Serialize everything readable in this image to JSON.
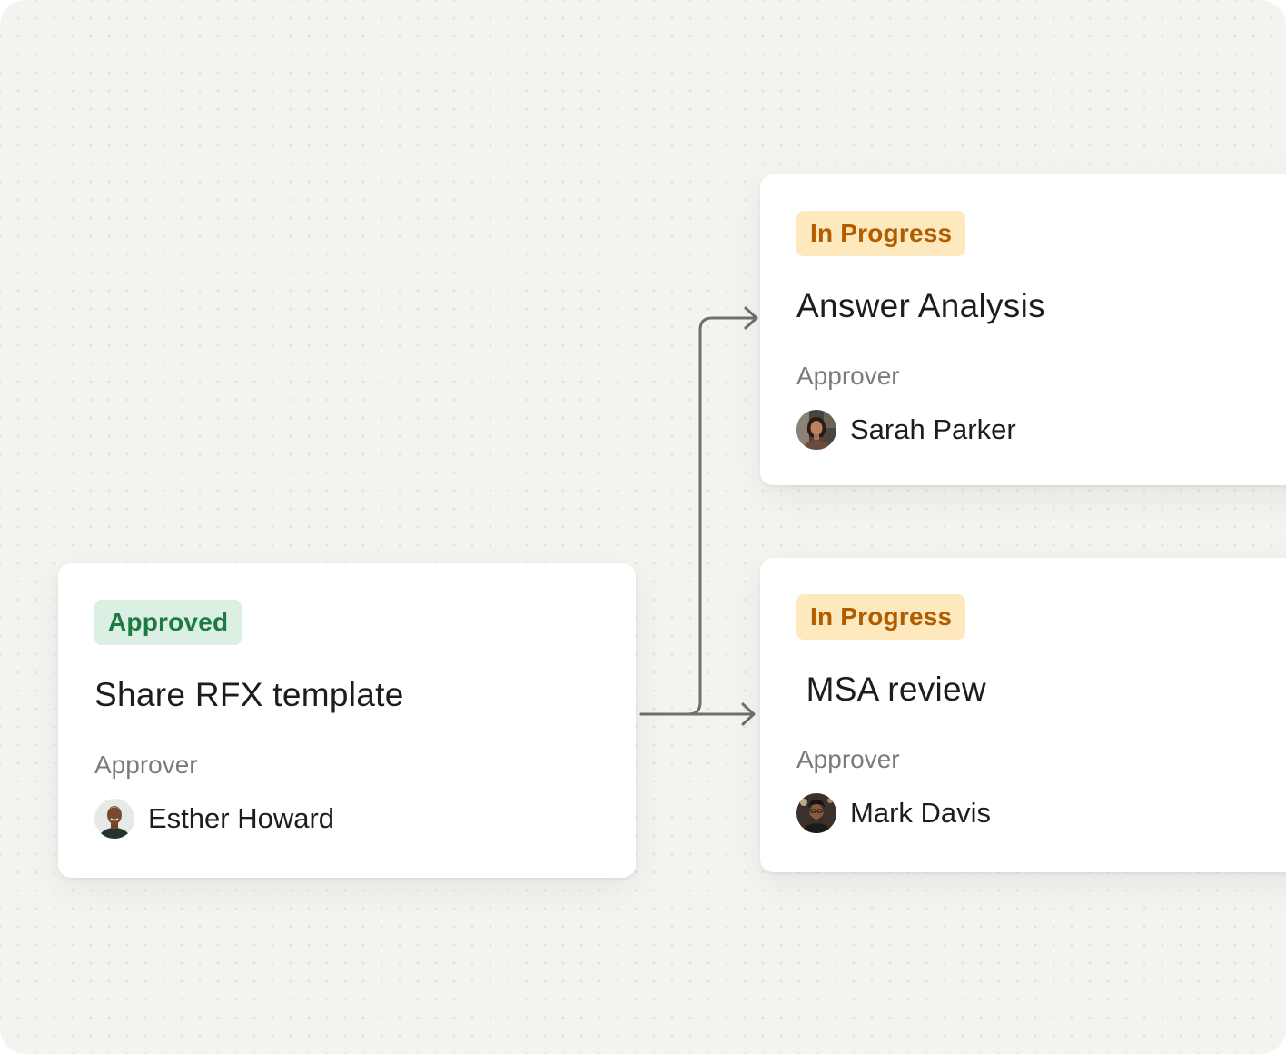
{
  "cards": [
    {
      "status": "Approved",
      "title": "Share RFX template",
      "approver_label": "Approver",
      "approver_name": "Esther Howard",
      "avatar_icon": "person-avatar-icon"
    },
    {
      "status": "In Progress",
      "title": "Answer Analysis",
      "approver_label": "Approver",
      "approver_name": "Sarah Parker",
      "avatar_icon": "person-avatar-icon"
    },
    {
      "status": "In Progress",
      "title": " MSA review",
      "approver_label": "Approver",
      "approver_name": "Mark Davis",
      "avatar_icon": "person-avatar-icon"
    }
  ],
  "colors": {
    "approved_bg": "#dcefe3",
    "approved_text": "#1d7a44",
    "in_progress_bg": "#fde9bd",
    "in_progress_text": "#b25c00",
    "connector": "#6f6f6f"
  }
}
